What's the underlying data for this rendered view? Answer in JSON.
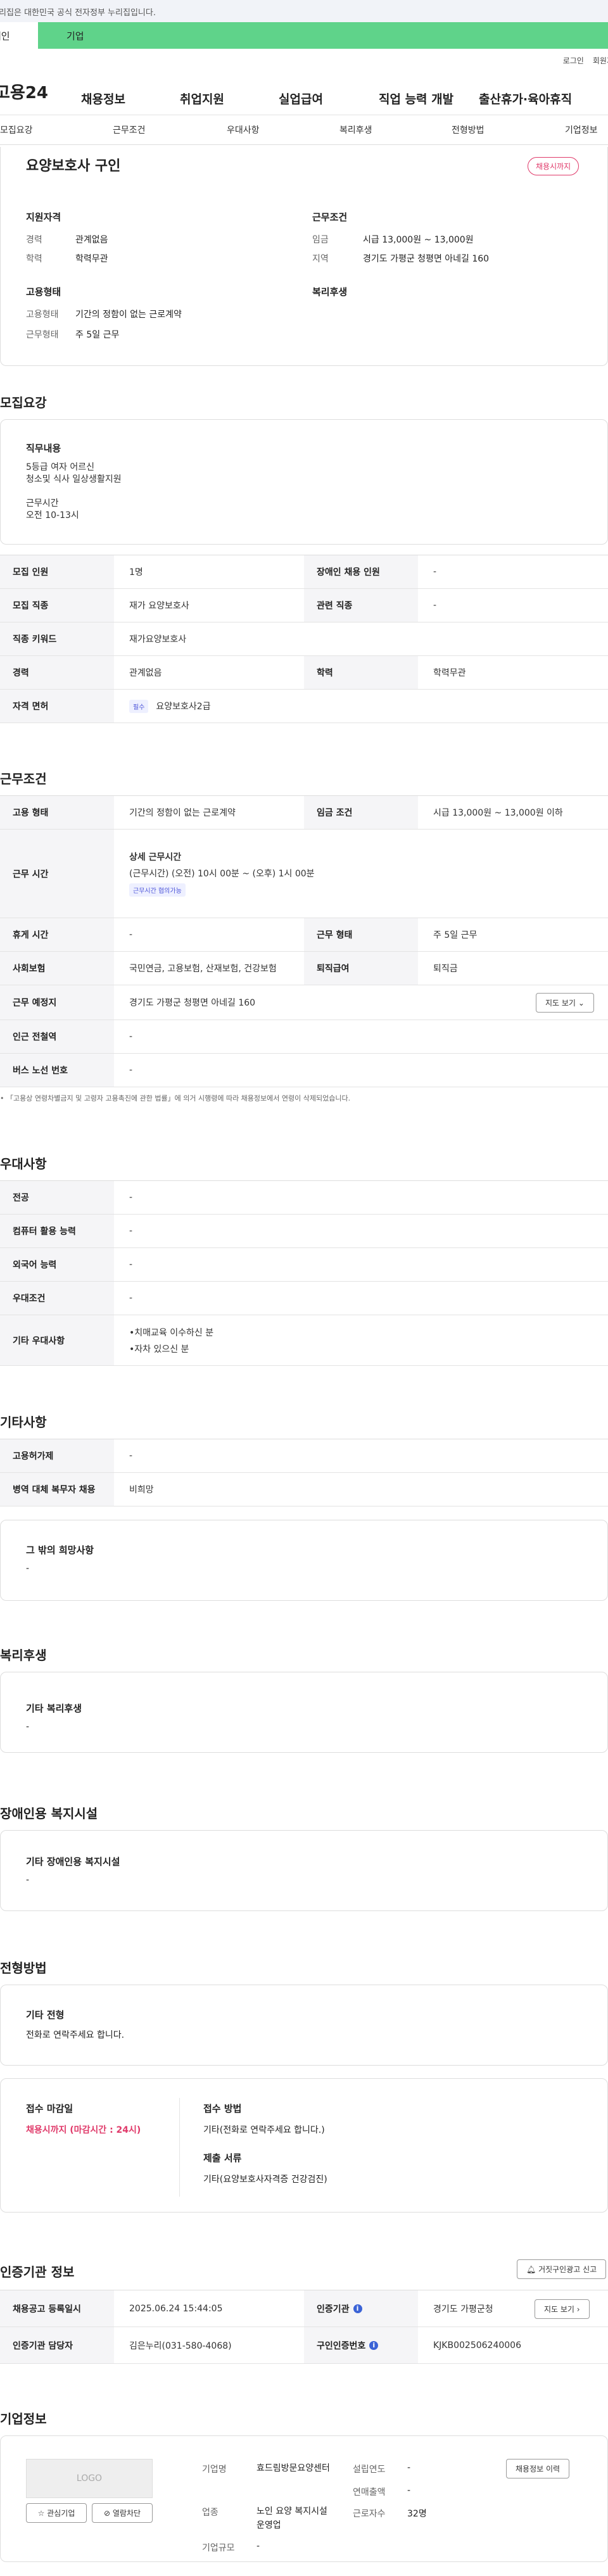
{
  "gov_banner": "이 누리집은 대한민국 공식 전자정부 누리집입니다.",
  "user_types": [
    "개인",
    "기업"
  ],
  "util_links": [
    "로그인",
    "회원가입"
  ],
  "logo": "고용24",
  "gnb": [
    "채용정보",
    "취업지원",
    "실업급여",
    "직업 능력 개발",
    "출산휴가·육아휴직"
  ],
  "tabs": [
    "모집요강",
    "근무조건",
    "우대사항",
    "복리후생",
    "전형방법",
    "기업정보"
  ],
  "summary": {
    "title": "요양보호사 구인",
    "badge": "채용시까지",
    "qual_title": "지원자격",
    "qual": [
      [
        "경력",
        "관계없음"
      ],
      [
        "학력",
        "학력무관"
      ]
    ],
    "cond_title": "근무조건",
    "cond": [
      [
        "임금",
        "시급 13,000원 ~ 13,000원"
      ],
      [
        "지역",
        "경기도 가평군 청평면 아네길 160"
      ]
    ],
    "emp_title": "고용형태",
    "emp": [
      [
        "고용형태",
        "기간의 정함이 없는 근로계약"
      ],
      [
        "근무형태",
        "주 5일 근무"
      ]
    ],
    "welfare_title": "복리후생"
  },
  "recruit": {
    "title": "모집요강",
    "duty_title": "직무내용",
    "duty_lines": [
      "5등급 여자 어르신",
      "청소및 식사 일상생활지원",
      "",
      "근무시간",
      "오전 10-13시"
    ],
    "rows": [
      [
        "모집 인원",
        "1명",
        "장애인 채용 인원",
        "-"
      ],
      [
        "모집 직종",
        "재가 요양보호사",
        "관련 직종",
        "-"
      ],
      [
        "직종 키워드",
        "재가요양보호사",
        "",
        ""
      ],
      [
        "경력",
        "관계없음",
        "학력",
        "학력무관"
      ]
    ],
    "license_label": "자격 면허",
    "license_chip": "필수",
    "license_value": "요양보호사2급"
  },
  "work": {
    "title": "근무조건",
    "emp_label": "고용 형태",
    "emp_value": "기간의 정함이 없는 근로계약",
    "wage_label": "임금 조건",
    "wage_value": "시급 13,000원 ~ 13,000원 이하",
    "time_label": "근무 시간",
    "time_head": "상세 근무시간",
    "time_value": "(근무시간) (오전) 10시 00분 ~ (오후) 1시 00분",
    "time_chip": "근무시간 협의가능",
    "rows": [
      [
        "휴게 시간",
        "-",
        "근무 형태",
        "주 5일 근무"
      ],
      [
        "사회보험",
        "국민연금, 고용보험, 산재보험, 건강보험",
        "퇴직급여",
        "퇴직금"
      ]
    ],
    "place_label": "근무 예정지",
    "place_value": "경기도 가평군 청평면 아네길 160",
    "map_btn": "지도 보기",
    "station_label": "인근 전철역",
    "station_value": "-",
    "bus_label": "버스 노선 번호",
    "bus_value": "-",
    "notice": "「고용상 연령차별금지 및 고령자 고용촉진에 관한 법률」에 의거 시행령에 따라 채용정보에서 연령이 삭제되었습니다."
  },
  "pref": {
    "title": "우대사항",
    "rows": [
      [
        "전공",
        "-"
      ],
      [
        "컴퓨터 활용 능력",
        "-"
      ],
      [
        "외국어 능력",
        "-"
      ],
      [
        "우대조건",
        "-"
      ]
    ],
    "etc_label": "기타 우대사항",
    "etc_lines": [
      "•치매교육 이수하신 분",
      "•자차 있으신 분"
    ]
  },
  "other": {
    "title": "기타사항",
    "rows": [
      [
        "고용허가제",
        "-"
      ],
      [
        "병역 대체 복무자 채용",
        "비희망"
      ]
    ],
    "box_title": "그 밖의 희망사항",
    "box_value": "-"
  },
  "welfare": {
    "title": "복리후생",
    "box_title": "기타 복리후생",
    "box_value": "-"
  },
  "disab": {
    "title": "장애인용 복지시설",
    "box_title": "기타 장애인용 복지시설",
    "box_value": "-"
  },
  "select": {
    "title": "전형방법",
    "etc_title": "기타 전형",
    "etc_value": "전화로 연락주세요 합니다.",
    "deadline_title": "접수 마감일",
    "deadline_value": "채용시까지 (마감시간 : 24시)",
    "method_title": "접수 방법",
    "method_value": "기타(전화로 연락주세요 합니다.)",
    "docs_title": "제출 서류",
    "docs_value": "기타(요양보호사자격증 건강검진)"
  },
  "agency": {
    "title": "인증기관 정보",
    "report_btn": "거짓구인광고 신고",
    "reg_label": "채용공고 등록일시",
    "reg_value": "2025.06.24 15:44:05",
    "org_label": "인증기관",
    "org_value": "경기도 가평군청",
    "map_btn": "지도 보기",
    "manager_label": "인증기관 담당자",
    "manager_value": "김은누리(031-580-4068)",
    "job_no_label": "구인인증번호",
    "job_no_value": "KJKB002506240006"
  },
  "company": {
    "title": "기업정보",
    "logo_placeholder": "LOGO",
    "fav_btn": "관심기업",
    "block_btn": "열람차단",
    "name_label": "기업명",
    "name_value": "효드림방문요양센터",
    "ind_label": "업종",
    "ind_value": "노인 요양 복지시설 운영업",
    "scale_label": "기업규모",
    "scale_value": "-",
    "year_label": "설립연도",
    "year_value": "-",
    "sales_label": "연매출액",
    "sales_value": "-",
    "emp_label": "근로자수",
    "emp_value": "32명",
    "history_btn": "채용정보 이력"
  },
  "colors": {
    "accent": "#5fd38a",
    "pink": "#e03a6a",
    "blue": "#3b63d6"
  }
}
